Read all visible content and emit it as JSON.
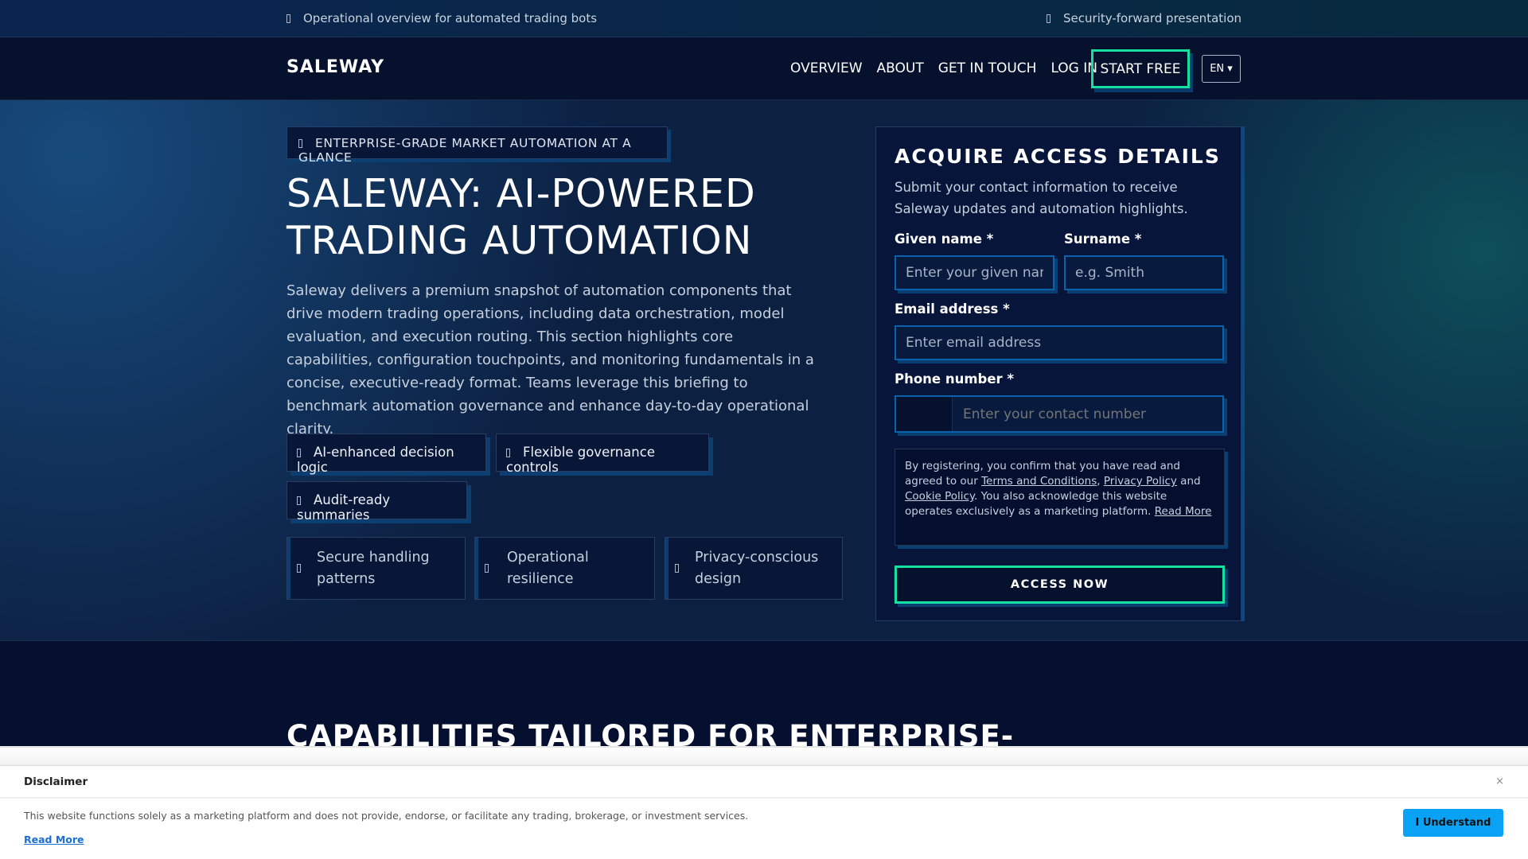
{
  "topbar": {
    "left": "Operational overview for automated trading bots",
    "right": "Security-forward presentation"
  },
  "nav": {
    "logo": "SALEWAY",
    "links": [
      "OVERVIEW",
      "ABOUT",
      "GET IN TOUCH",
      "LOG IN"
    ],
    "cta": "START FREE",
    "lang": "EN ▾"
  },
  "hero": {
    "badge": "ENTERPRISE-GRADE MARKET AUTOMATION AT A GLANCE",
    "title_line1": "SALEWAY: AI-POWERED",
    "title_line2": "TRADING AUTOMATION",
    "description": "Saleway delivers a premium snapshot of automation components that drive modern trading operations, including data orchestration, model evaluation, and execution routing. This section highlights core capabilities, configuration touchpoints, and monitoring fundamentals in a concise, executive-ready format. Teams leverage this briefing to benchmark automation governance and enhance day-to-day operational clarity.",
    "chips": [
      "AI-enhanced decision logic",
      "Flexible governance controls",
      "Audit-ready summaries"
    ],
    "cards": [
      "Secure handling patterns",
      "Operational resilience",
      "Privacy-conscious design"
    ]
  },
  "form": {
    "title": "ACQUIRE ACCESS DETAILS",
    "subtitle": "Submit your contact information to receive Saleway updates and automation highlights.",
    "given_label": "Given name *",
    "given_placeholder": "Enter your given name",
    "surname_label": "Surname *",
    "surname_placeholder": "e.g. Smith",
    "email_label": "Email address *",
    "email_placeholder": "Enter email address",
    "phone_label": "Phone number *",
    "phone_placeholder": "Enter your contact number",
    "consent": {
      "p1": "By registering, you confirm that you have read and agreed to our ",
      "terms": "Terms and Conditions",
      "sep": ", ",
      "privacy": "Privacy Policy",
      "and": " and ",
      "cookie": "Cookie Policy",
      "p2": ". You also acknowledge this website operates exclusively as a marketing platform. ",
      "read_more": "Read More"
    },
    "submit": "ACCESS NOW"
  },
  "section": {
    "heading": "CAPABILITIES TAILORED FOR ENTERPRISE-"
  },
  "disclaimer": {
    "title": "Disclaimer",
    "close": "×",
    "text": "This website functions solely as a marketing platform and does not provide, endorse, or facilitate any trading, brokerage, or investment services.",
    "read_more": "Read More",
    "button": "I Understand"
  }
}
